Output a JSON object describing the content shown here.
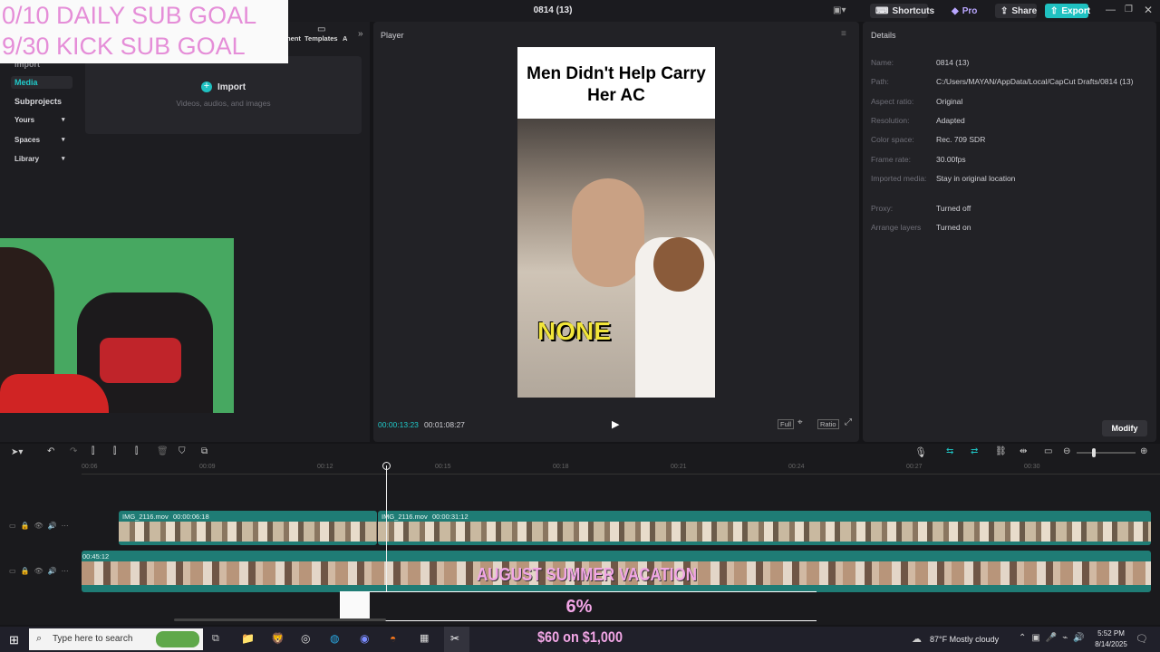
{
  "overlay": {
    "line1": "0/10 DAILY SUB GOAL",
    "line2": "9/30 KICK SUB GOAL"
  },
  "titlebar": {
    "title": "0814 (13)",
    "shortcuts": "Shortcuts",
    "pro": "Pro",
    "share": "Share",
    "export": "Export"
  },
  "media_tabs": {
    "tab1": "ment",
    "tab2": "Templates",
    "tab3": "A"
  },
  "sidebar": {
    "items": [
      {
        "label": "Import"
      },
      {
        "label": "Media"
      },
      {
        "label": "Subprojects"
      },
      {
        "label": "Yours"
      },
      {
        "label": "Spaces"
      },
      {
        "label": "Library"
      }
    ]
  },
  "import": {
    "label": "Import",
    "hint": "Videos, audios, and images"
  },
  "player": {
    "title": "Player",
    "current_time": "00:00:13:23",
    "total_time": "00:01:08:27",
    "full": "Full",
    "ratio": "Ratio",
    "video_caption_top": "Men Didn't Help Carry Her AC",
    "video_caption_overlay": "NONE"
  },
  "details": {
    "title": "Details",
    "rows": [
      {
        "label": "Name:",
        "value": "0814 (13)"
      },
      {
        "label": "Path:",
        "value": "C:/Users/MAYAN/AppData/Local/CapCut Drafts/0814 (13)"
      },
      {
        "label": "Aspect ratio:",
        "value": "Original"
      },
      {
        "label": "Resolution:",
        "value": "Adapted"
      },
      {
        "label": "Color space:",
        "value": "Rec. 709 SDR"
      },
      {
        "label": "Frame rate:",
        "value": "30.00fps"
      },
      {
        "label": "Imported media:",
        "value": "Stay in original location"
      },
      {
        "label": "Proxy:",
        "value": "Turned off"
      },
      {
        "label": "Arrange layers",
        "value": "Turned on"
      }
    ],
    "modify": "Modify"
  },
  "timeline": {
    "ticks": [
      "00:06",
      "00:09",
      "00:12",
      "00:15",
      "00:18",
      "00:21",
      "00:24",
      "00:27",
      "00:30"
    ],
    "clip1_name": "IMG_2116.mov",
    "clip1_dur": "00:00:06:18",
    "clip2_name": "IMG_2116.mov",
    "clip2_dur": "00:00:31:12",
    "main_time": "00:45:12",
    "stream_banner": "AUGUST SUMMER VACATION",
    "goal_percent": "6%",
    "goal_amount": "$60 on $1,000"
  },
  "taskbar": {
    "search_placeholder": "Type here to search",
    "weather": "87°F  Mostly cloudy",
    "time": "5:52 PM",
    "date": "8/14/2025"
  }
}
